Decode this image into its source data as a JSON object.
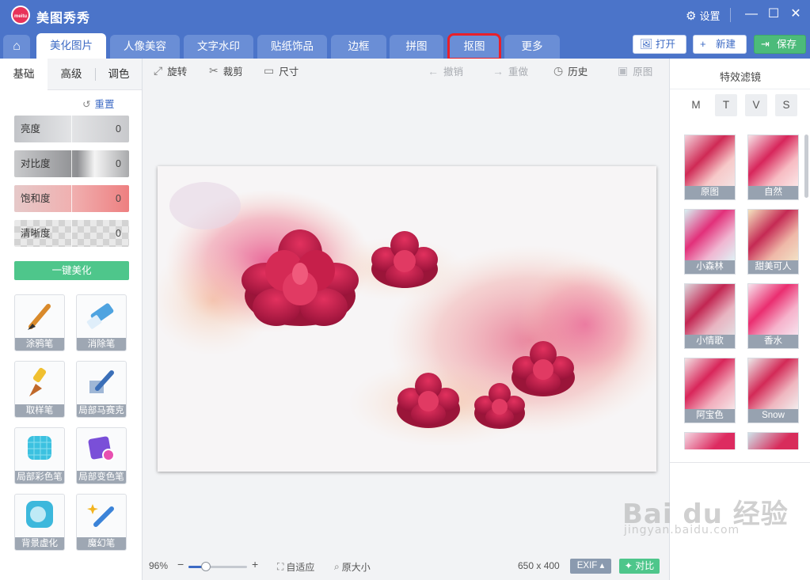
{
  "app": {
    "title": "美图秀秀",
    "logo_text": "meitu",
    "settings_label": "设置",
    "window_controls": [
      "—",
      "☐",
      "✕"
    ]
  },
  "tabs": [
    {
      "label": "美化图片",
      "active": true
    },
    {
      "label": "人像美容"
    },
    {
      "label": "文字水印"
    },
    {
      "label": "贴纸饰品"
    },
    {
      "label": "边框"
    },
    {
      "label": "拼图"
    },
    {
      "label": "抠图",
      "highlighted": true
    },
    {
      "label": "更多"
    }
  ],
  "topbar_buttons": {
    "open": "打开",
    "new": "新建",
    "save": "保存"
  },
  "left_panel": {
    "subtabs": [
      "基础",
      "高级",
      "调色"
    ],
    "reset_label": "重置",
    "sliders": [
      {
        "label": "亮度",
        "value": "0"
      },
      {
        "label": "对比度",
        "value": "0"
      },
      {
        "label": "饱和度",
        "value": "0"
      },
      {
        "label": "清晰度",
        "value": "0"
      }
    ],
    "one_click_label": "一键美化",
    "tools": [
      {
        "label": "涂鸦笔",
        "icon": "brush-icon"
      },
      {
        "label": "消除笔",
        "icon": "eraser-icon"
      },
      {
        "label": "取样笔",
        "icon": "sample-brush-icon"
      },
      {
        "label": "局部马赛克",
        "icon": "mosaic-pen-icon"
      },
      {
        "label": "局部彩色笔",
        "icon": "color-pen-icon"
      },
      {
        "label": "局部变色笔",
        "icon": "recolor-pen-icon"
      },
      {
        "label": "背景虚化",
        "icon": "blur-icon"
      },
      {
        "label": "魔幻笔",
        "icon": "magic-pen-icon"
      }
    ]
  },
  "canvas_toolbar": {
    "rotate": "旋转",
    "crop": "裁剪",
    "size": "尺寸",
    "undo": "撤销",
    "redo": "重做",
    "history": "历史",
    "original": "原图"
  },
  "bottom_bar": {
    "zoom": "96%",
    "zoom_level": 0.3,
    "fit": "自适应",
    "actual_size": "原大小",
    "dimensions": "650 x 400",
    "exif": "EXIF ▴",
    "compare": "对比"
  },
  "right_panel": {
    "title": "特效滤镜",
    "categories": [
      {
        "label": "M",
        "active": true
      },
      {
        "label": "T"
      },
      {
        "label": "V"
      },
      {
        "label": "S"
      }
    ],
    "filters": [
      "原图",
      "自然",
      "小森林",
      "甜美可人",
      "小情歌",
      "香水",
      "阿宝色",
      "Snow"
    ]
  },
  "watermark": {
    "big": "Bai du 经验",
    "small": "jingyan.baidu.com"
  },
  "colors": {
    "accent": "#4b74c9",
    "green": "#4ec68b",
    "highlight_border": "#e8202a"
  }
}
